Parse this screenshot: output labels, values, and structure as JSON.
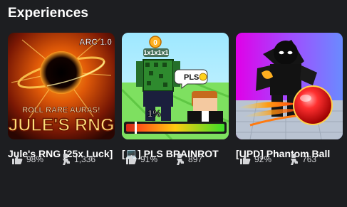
{
  "section": {
    "title": "Experiences"
  },
  "cards": [
    {
      "title": "Jule's RNG [25x Luck]",
      "thumb_text": {
        "arc": "ARC 1.0",
        "tagline": "ROLL RARE AURAS!",
        "logo": "JULE'S RNG"
      },
      "rating": "98%",
      "players": "1,336"
    },
    {
      "title": "[💻] PLS BRAINROT",
      "thumb_text": {
        "badge": "1x1x1x1",
        "bubble": "PLS",
        "percent": "1%"
      },
      "rating": "91%",
      "players": "897"
    },
    {
      "title": "[UPD] Phantom Ball",
      "rating": "92%",
      "players": "763"
    }
  ],
  "icons": {
    "rating": "thumbs-up-icon",
    "players": "player-count-icon"
  }
}
